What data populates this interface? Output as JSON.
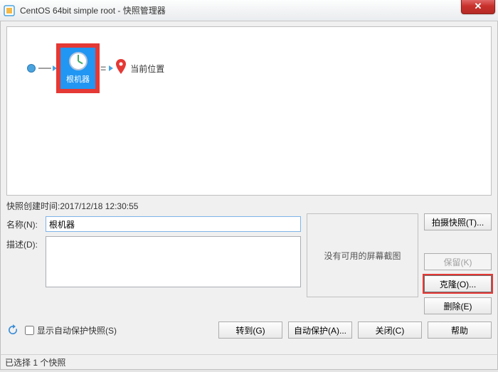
{
  "titlebar": {
    "icon": "vmware-icon",
    "title": "CentOS 64bit simple root - 快照管理器"
  },
  "graph": {
    "root_label": "根机器",
    "current_label": "当前位置"
  },
  "details": {
    "created_label": "快照创建时间:",
    "created_value": "2017/12/18 12:30:55",
    "name_label": "名称(N):",
    "name_value": "根机器",
    "desc_label": "描述(D):",
    "desc_value": "",
    "screenshot_placeholder": "没有可用的屏幕截图"
  },
  "side_buttons": {
    "take": "拍摄快照(T)...",
    "keep": "保留(K)",
    "clone": "克隆(O)...",
    "delete": "删除(E)"
  },
  "bottom": {
    "autoprotect_label": "显示自动保护快照(S)",
    "goto": "转到(G)",
    "autoprotect_btn": "自动保护(A)...",
    "close": "关闭(C)",
    "help": "帮助"
  },
  "statusbar": {
    "text": "已选择 1 个快照"
  }
}
